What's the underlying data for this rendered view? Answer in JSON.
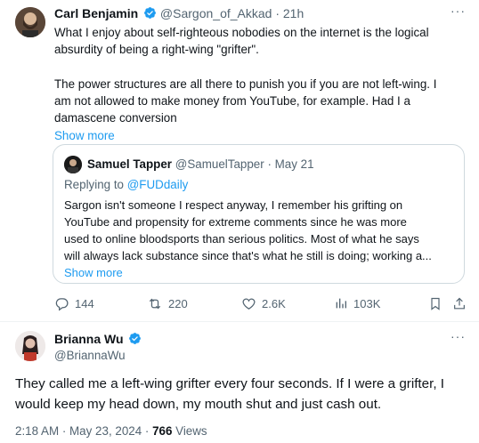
{
  "tweet1": {
    "author_name": "Carl Benjamin",
    "handle": "@Sargon_of_Akkad",
    "separator": "·",
    "time": "21h",
    "text_lines": [
      "What I enjoy about self-righteous nobodies on the internet is the logical",
      "absurdity of being a right-wing \"grifter\".",
      "",
      "The power structures are all there to punish you if you are not left-wing. I",
      "am not allowed to make money from YouTube, for example. Had I a",
      "damascene conversion"
    ],
    "show_more": "Show more",
    "quote": {
      "author_name": "Samuel Tapper",
      "handle": "@SamuelTapper",
      "separator": "·",
      "time": "May 21",
      "replying_prefix": "Replying to ",
      "replying_handle": "@FUDdaily",
      "text_lines": [
        "Sargon isn't someone I respect anyway, I remember his grifting on",
        "YouTube and propensity for extreme comments since he was more",
        "used to online bloodsports than serious politics. Most of what he says",
        "will always lack substance since that's what he still is doing; working a..."
      ],
      "show_more": "Show more"
    },
    "actions": {
      "replies": "144",
      "reposts": "220",
      "likes": "2.6K",
      "views": "103K"
    }
  },
  "tweet2": {
    "author_name": "Brianna Wu",
    "handle": "@BriannaWu",
    "text_lines": [
      "They called me a left-wing grifter every four seconds. If I were a grifter, I",
      "would keep my head down, my mouth shut and just cash out."
    ],
    "timestamp": "2:18 AM · May 23, 2024 · ",
    "views_count": "766",
    "views_label": " Views"
  },
  "more_menu": "···",
  "colors": {
    "accent": "#1d9bf0",
    "muted": "#536471",
    "text": "#0f1419",
    "border": "#cfd9de"
  }
}
